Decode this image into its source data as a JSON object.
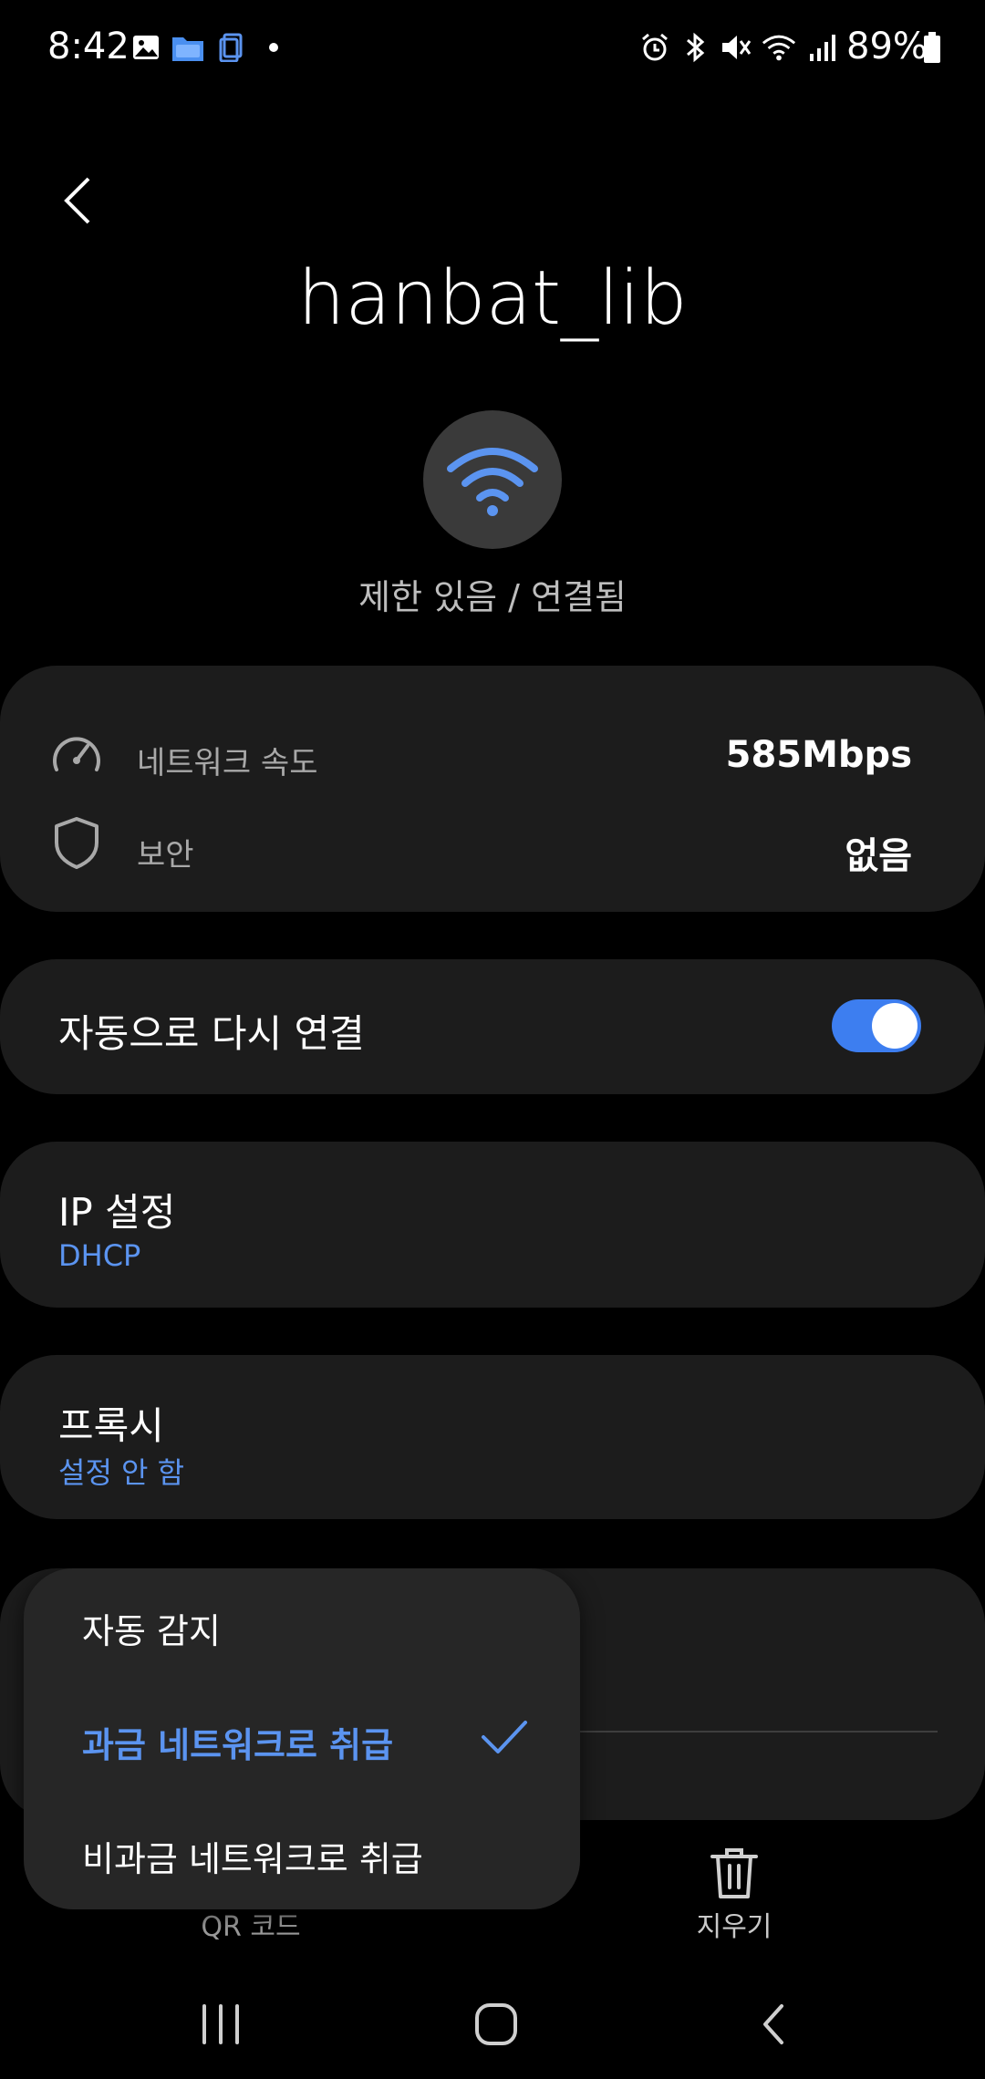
{
  "status_bar": {
    "time": "8:42",
    "battery": "89%"
  },
  "header": {
    "back_label": "뒤로",
    "title": "hanbat_lib",
    "connection_status": "제한 있음 / 연결됨"
  },
  "info": {
    "speed_label": "네트워크 속도",
    "speed_value": "585Mbps",
    "security_label": "보안",
    "security_value": "없음"
  },
  "auto_reconnect": {
    "label": "자동으로 다시 연결",
    "enabled": true
  },
  "ip_settings": {
    "title": "IP 설정",
    "value": "DHCP"
  },
  "proxy": {
    "title": "프록시",
    "value": "설정 안 함"
  },
  "metered_dropdown": {
    "options": [
      "자동 감지",
      "과금 네트워크로 취급",
      "비과금 네트워크로 취급"
    ],
    "selected_index": 1
  },
  "bottom_actions": {
    "qr_label": "QR 코드",
    "delete_label": "지우기"
  },
  "colors": {
    "accent": "#5b94f0",
    "toggle_on": "#3d7ef0",
    "card_bg": "#1c1c1c",
    "dropdown_bg": "#262626"
  }
}
